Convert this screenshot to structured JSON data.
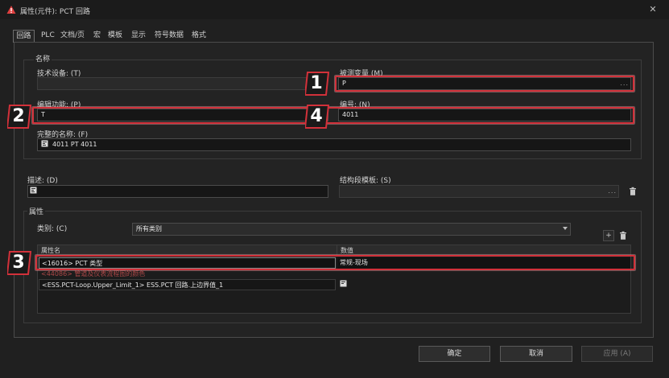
{
  "window": {
    "title": "属性(元件): PCT 回路",
    "close_glyph": "✕",
    "app_icon": "warning-triangle-icon"
  },
  "tabs": [
    {
      "label": "回路",
      "active": true
    },
    {
      "label": "PLC"
    },
    {
      "label": "文档/页"
    },
    {
      "label": "宏"
    },
    {
      "label": "模板"
    },
    {
      "label": "显示"
    },
    {
      "label": "符号数据"
    },
    {
      "label": "格式"
    }
  ],
  "name_group": {
    "label": "名称",
    "tech_device": {
      "label": "技术设备: (T)",
      "value": ""
    },
    "measured_variable": {
      "label": "被测变量 (M)",
      "value": "P",
      "ellipsis": "..."
    },
    "edit_function": {
      "label": "编辑功能: (P)",
      "value": "T"
    },
    "number": {
      "label": "编号: (N)",
      "value": "4011"
    },
    "full_name": {
      "label": "完整的名称: (F)",
      "value": "4011 PT 4011"
    }
  },
  "description": {
    "label": "描述: (D)",
    "value": ""
  },
  "structure_template": {
    "label": "结构段模板: (S)",
    "value": "",
    "ellipsis": "..."
  },
  "properties": {
    "group_label": "属性",
    "category_label": "类别: (C)",
    "category_value": "所有类别",
    "add_glyph": "+",
    "columns": [
      "属性名",
      "数值"
    ],
    "rows": [
      {
        "name": "<16016> PCT 类型",
        "value": "常规-现场"
      },
      {
        "name": "<44086> 管道及仪表流程图的颜色",
        "value": ""
      },
      {
        "name": "<ESS.PCT-Loop.Upper_Limit_1> ESS.PCT 回路.上边界值_1",
        "value": ""
      }
    ]
  },
  "callouts": [
    "1",
    "2",
    "3",
    "4"
  ],
  "buttons": {
    "ok": "确定",
    "cancel": "取消",
    "apply": "应用 (A)"
  },
  "colors": {
    "callout_red": "#d2313a",
    "background": "#202020",
    "row2_text": "#b04848"
  }
}
